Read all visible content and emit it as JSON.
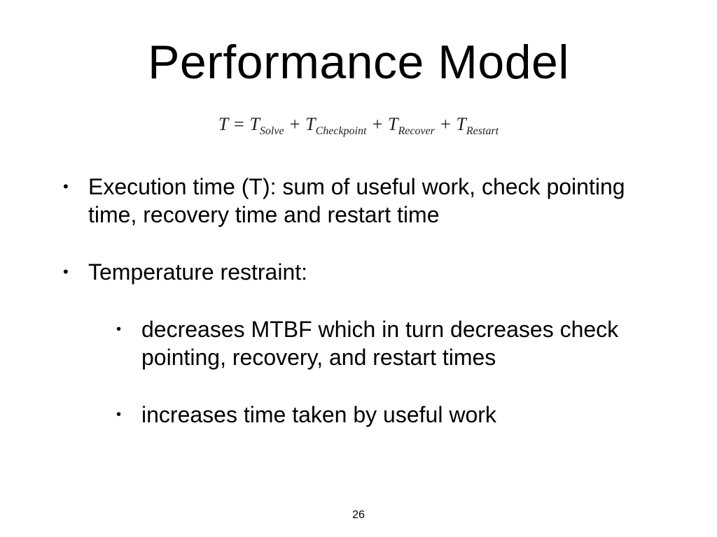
{
  "title": "Performance Model",
  "formula": {
    "lhs": "T",
    "eq": " = ",
    "terms": [
      {
        "base": "T",
        "sub": "Solve"
      },
      {
        "base": "T",
        "sub": "Checkpoint"
      },
      {
        "base": "T",
        "sub": "Recover"
      },
      {
        "base": "T",
        "sub": "Restart"
      }
    ],
    "plus": " + "
  },
  "bullets": {
    "b1": "Execution time (T): sum of useful work, check pointing time, recovery time and restart time",
    "b2": "Temperature restraint:",
    "b2a": "decreases MTBF which in turn decreases check pointing, recovery, and restart times",
    "b2b": "increases time taken by useful work"
  },
  "page_number": "26"
}
